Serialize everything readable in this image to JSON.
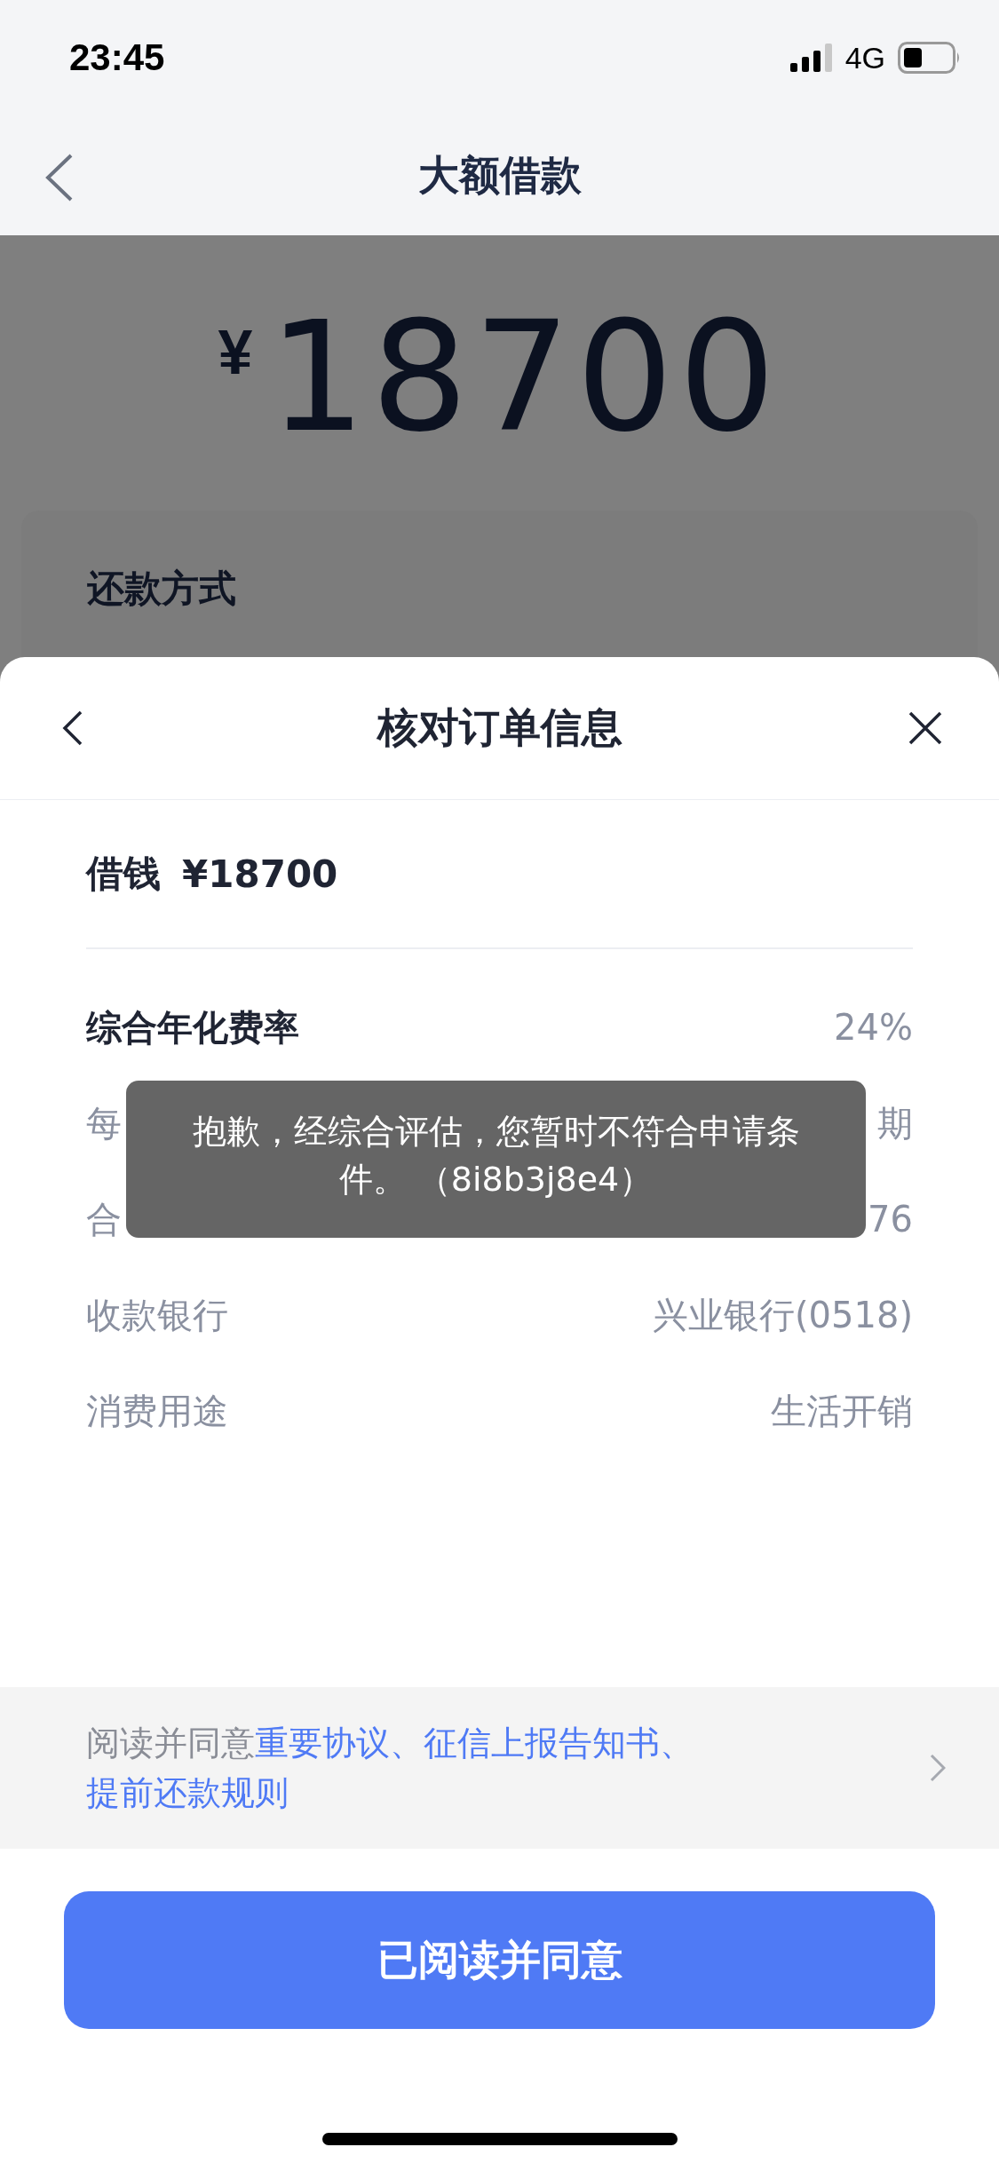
{
  "status_bar": {
    "time": "23:45",
    "network": "4G"
  },
  "nav": {
    "title": "大额借款"
  },
  "background": {
    "currency": "¥",
    "amount": "18700",
    "section_label": "还款方式"
  },
  "sheet": {
    "title": "核对订单信息",
    "loan": {
      "label": "借钱",
      "value": "¥18700"
    },
    "rows": [
      {
        "kind": "bold",
        "label": "综合年化费率",
        "value": "24%"
      },
      {
        "kind": "plain",
        "label": "每",
        "value": "期"
      },
      {
        "kind": "plain",
        "label": "合",
        "value": "76"
      },
      {
        "kind": "plain",
        "label": "收款银行",
        "value": "兴业银行(0518)"
      },
      {
        "kind": "plain",
        "label": "消费用途",
        "value": "生活开销"
      }
    ],
    "agreement": {
      "prefix": "阅读并同意",
      "links": [
        "重要协议",
        "征信上报告知书",
        "提前还款规则"
      ],
      "separator": "、"
    },
    "button": "已阅读并同意"
  },
  "toast": {
    "message": "抱歉，经综合评估，您暂时不符合申请条件。 （8i8b3j8e4）"
  }
}
